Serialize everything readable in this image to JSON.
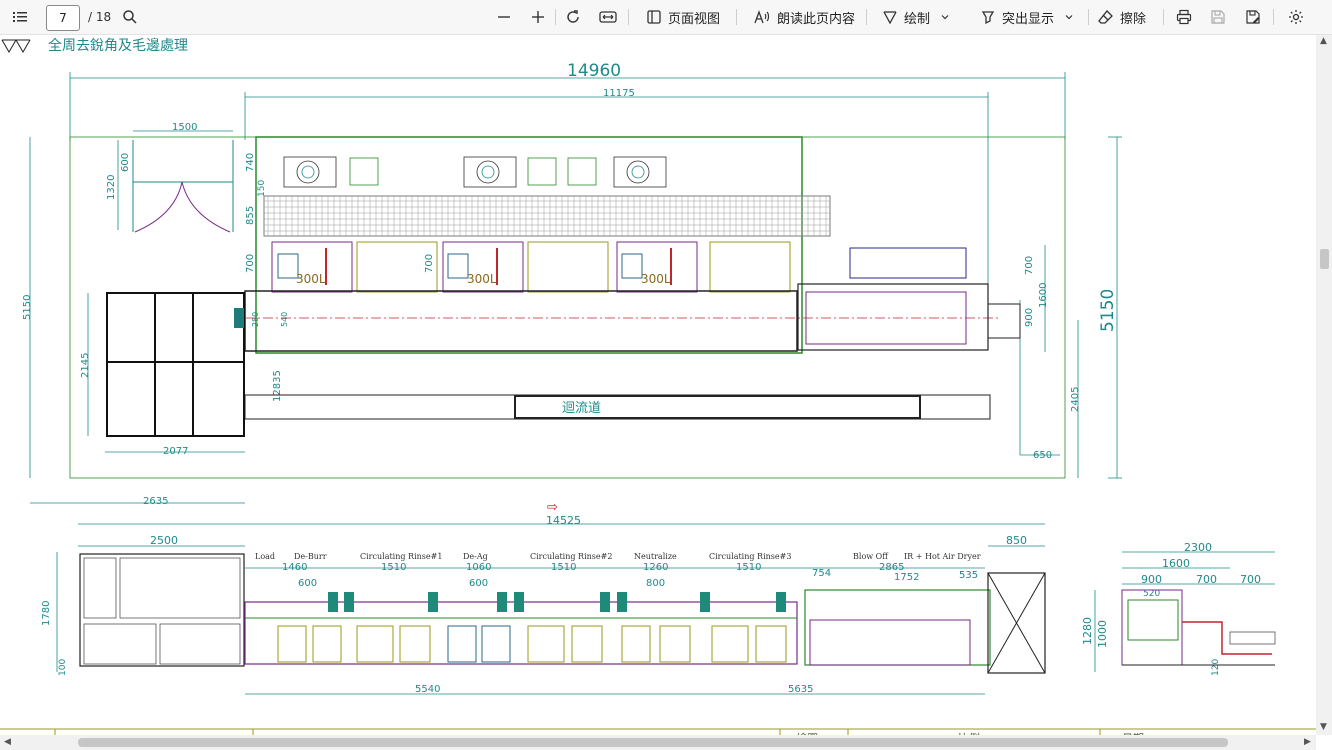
{
  "toolbar": {
    "page_number": "7",
    "page_total": "/ 18",
    "page_view_label": "页面视图",
    "read_aloud_label": "朗读此页内容",
    "draw_label": "绘制",
    "highlight_label": "突出显示",
    "erase_label": "擦除"
  },
  "document": {
    "heading": "全周去銳角及毛邊處理",
    "top_plan": {
      "overall_width": "14960",
      "inner_width": "11175",
      "overall_height": "5150",
      "left_height": "5150",
      "tank_label": "300L",
      "return_channel_label": "迴流道",
      "door_width": "1500",
      "door_depth": "600",
      "door_height": "1320",
      "dim_740": "740",
      "dim_855": "855",
      "dim_150": "150",
      "dim_700_a": "700",
      "dim_700_b": "700",
      "dim_700_c": "700",
      "dim_1600": "1600",
      "dim_900": "900",
      "dim_2145": "2145",
      "dim_12835": "12835",
      "dim_2077": "2077",
      "dim_2635": "2635",
      "dim_2405": "2405",
      "dim_650": "650",
      "dim_280": "280",
      "dim_540": "540"
    },
    "elevation": {
      "total_length": "14525",
      "load_width": "2500",
      "end_width": "850",
      "height_1780": "1780",
      "height_100": "100",
      "station_labels": [
        "Load",
        "De-Burr",
        "Circulating Rinse#1",
        "De-Ag",
        "Circulating Rinse#2",
        "Neutralize",
        "Circulating Rinse#3",
        "Blow Off",
        "IR + Hot Air Dryer"
      ],
      "station_widths": [
        "1460",
        "1510",
        "1060",
        "1510",
        "1260",
        "1510"
      ],
      "sub_widths": [
        "600",
        "600",
        "800"
      ],
      "dryer_widths": [
        "754",
        "2865",
        "1752",
        "535"
      ],
      "bottom_dims": [
        "5540",
        "5635"
      ]
    },
    "side_view": {
      "widths": [
        "2300",
        "1600",
        "900",
        "700",
        "700"
      ],
      "heights": [
        "1280",
        "1000",
        "120"
      ],
      "dim_520": "520"
    },
    "title_block_fragments": [
      "繪圖",
      "比例",
      "日期"
    ]
  },
  "colors": {
    "dimension": "#1f8a8a",
    "frame": "#1c1c1c",
    "tank_green": "#2a8a2a",
    "tank_purple": "#7a2a8a",
    "tank_olive": "#9a9a1a",
    "accent_red": "#c0262a",
    "grid_gray": "#7a7a7a"
  }
}
